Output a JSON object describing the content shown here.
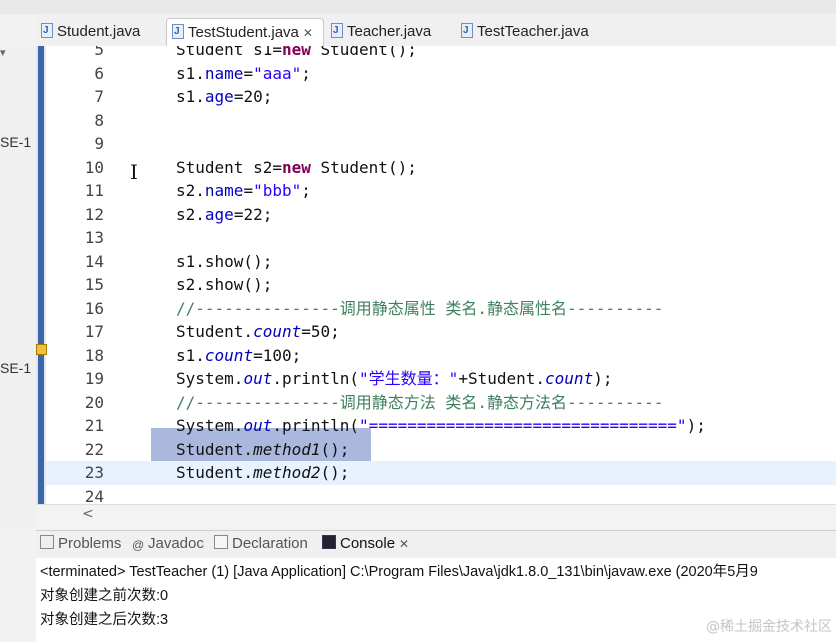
{
  "tabs": [
    {
      "label": "Student.java",
      "active": false
    },
    {
      "label": "TestStudent.java",
      "active": true
    },
    {
      "label": "Teacher.java",
      "active": false
    },
    {
      "label": "TestTeacher.java",
      "active": false
    }
  ],
  "left_pane_labels": [
    "SE-1",
    "SE-1"
  ],
  "editor": {
    "lines": [
      {
        "num": "5",
        "segs": [
          [
            "p",
            "Student s1="
          ],
          [
            "kw",
            "new"
          ],
          [
            "p",
            " Student();"
          ]
        ]
      },
      {
        "num": "6",
        "segs": [
          [
            "p",
            "s1."
          ],
          [
            "fld",
            "name"
          ],
          [
            "p",
            "="
          ],
          [
            "str",
            "\"aaa\""
          ],
          [
            "p",
            ";"
          ]
        ]
      },
      {
        "num": "7",
        "segs": [
          [
            "p",
            "s1."
          ],
          [
            "fld",
            "age"
          ],
          [
            "p",
            "=20;"
          ]
        ]
      },
      {
        "num": "8",
        "segs": []
      },
      {
        "num": "9",
        "segs": []
      },
      {
        "num": "10",
        "segs": [
          [
            "p",
            "Student s2="
          ],
          [
            "kw",
            "new"
          ],
          [
            "p",
            " Student();"
          ]
        ]
      },
      {
        "num": "11",
        "segs": [
          [
            "p",
            "s2."
          ],
          [
            "fld",
            "name"
          ],
          [
            "p",
            "="
          ],
          [
            "str",
            "\"bbb\""
          ],
          [
            "p",
            ";"
          ]
        ]
      },
      {
        "num": "12",
        "segs": [
          [
            "p",
            "s2."
          ],
          [
            "fld",
            "age"
          ],
          [
            "p",
            "=22;"
          ]
        ]
      },
      {
        "num": "13",
        "segs": []
      },
      {
        "num": "14",
        "segs": [
          [
            "p",
            "s1.show();"
          ]
        ]
      },
      {
        "num": "15",
        "segs": [
          [
            "p",
            "s2.show();"
          ]
        ]
      },
      {
        "num": "16",
        "segs": [
          [
            "cmt",
            "//---------------调用静态属性 类名.静态属性名----------"
          ]
        ]
      },
      {
        "num": "17",
        "segs": [
          [
            "p",
            "Student."
          ],
          [
            "sfld",
            "count"
          ],
          [
            "p",
            "=50;"
          ]
        ]
      },
      {
        "num": "18",
        "segs": [
          [
            "p",
            "s1."
          ],
          [
            "sfld",
            "count"
          ],
          [
            "p",
            "=100;"
          ]
        ]
      },
      {
        "num": "19",
        "segs": [
          [
            "p",
            "System."
          ],
          [
            "sfld",
            "out"
          ],
          [
            "p",
            ".println("
          ],
          [
            "str",
            "\"学生数量：\""
          ],
          [
            "p",
            "+Student."
          ],
          [
            "sfld",
            "count"
          ],
          [
            "p",
            ");"
          ]
        ]
      },
      {
        "num": "20",
        "segs": [
          [
            "cmt",
            "//---------------调用静态方法 类名.静态方法名----------"
          ]
        ]
      },
      {
        "num": "21",
        "segs": [
          [
            "p",
            "System."
          ],
          [
            "sfld",
            "out"
          ],
          [
            "p",
            ".println("
          ],
          [
            "str",
            "\"================================\""
          ],
          [
            "p",
            ");"
          ]
        ]
      },
      {
        "num": "22",
        "segs": [
          [
            "p",
            "Student."
          ],
          [
            "smeth",
            "method1"
          ],
          [
            "p",
            "();"
          ]
        ]
      },
      {
        "num": "23",
        "segs": [
          [
            "p",
            "Student."
          ],
          [
            "smeth",
            "method2"
          ],
          [
            "p",
            "();"
          ]
        ]
      },
      {
        "num": "24",
        "segs": []
      }
    ]
  },
  "scroll_left_glyph": "<",
  "panel_tabs": [
    {
      "label": "Problems",
      "active": false
    },
    {
      "label": "Javadoc",
      "active": false
    },
    {
      "label": "Declaration",
      "active": false
    },
    {
      "label": "Console",
      "active": true
    }
  ],
  "console": {
    "header": "<terminated> TestTeacher (1) [Java Application] C:\\Program Files\\Java\\jdk1.8.0_131\\bin\\javaw.exe (2020年5月9",
    "lines": [
      "对象创建之前次数:0",
      "对象创建之后次数:3"
    ]
  },
  "watermark": "@稀土掘金技术社区"
}
